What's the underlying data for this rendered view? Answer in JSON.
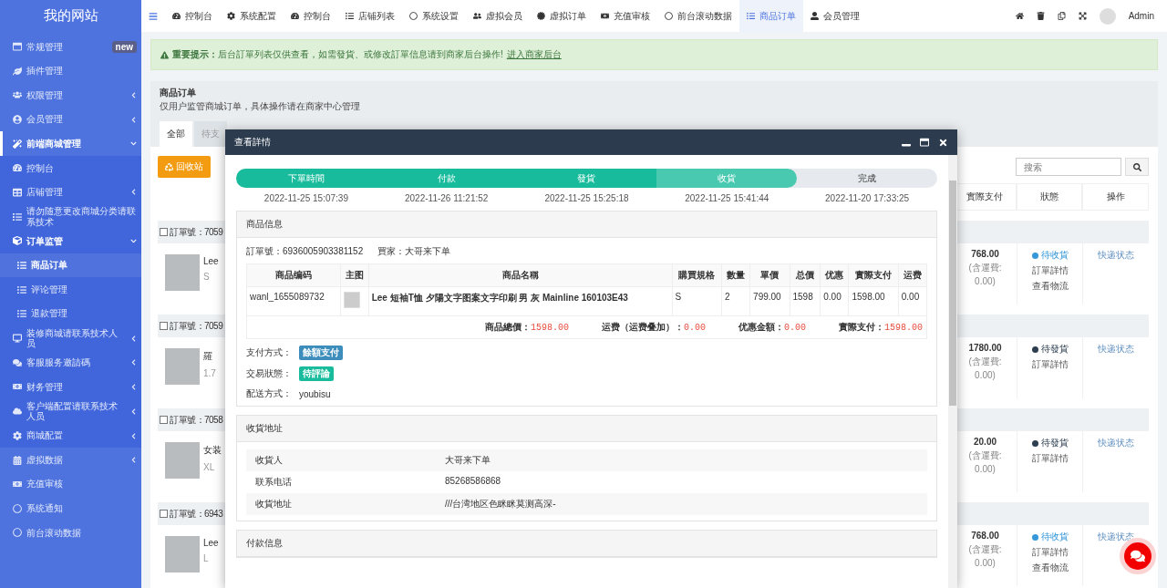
{
  "sidebar": {
    "title": "我的网站",
    "items": [
      {
        "label": "常规管理",
        "badge": "new",
        "selected": false
      },
      {
        "label": "插件管理",
        "selected": false
      },
      {
        "label": "权限管理",
        "expanded": false,
        "selected": false
      },
      {
        "label": "会员管理",
        "expanded": false,
        "selected": false
      },
      {
        "label": "前端商城管理",
        "expanded": true,
        "selected": false,
        "children": [
          {
            "label": "控制台",
            "selected": false
          },
          {
            "label": "店铺管理",
            "expanded": false,
            "selected": false
          },
          {
            "label": "请勿随意更改商城分类请联系技术",
            "selected": false
          },
          {
            "label": "订单监管",
            "expanded": true,
            "selected": false,
            "children": [
              {
                "label": "商品订单",
                "selected": true
              },
              {
                "label": "评论管理",
                "selected": false
              },
              {
                "label": "退款管理",
                "selected": false
              }
            ]
          },
          {
            "label": "装修商城请联系技术人员",
            "expanded": false,
            "selected": false
          },
          {
            "label": "客服服务邀請碼",
            "expanded": false,
            "selected": false
          },
          {
            "label": "财务管理",
            "expanded": false,
            "selected": false
          },
          {
            "label": "客户端配置请联系技术人员",
            "expanded": false,
            "selected": false
          },
          {
            "label": "商城配置",
            "expanded": false,
            "selected": false
          }
        ]
      },
      {
        "label": "虚拟数据",
        "expanded": false,
        "selected": false
      },
      {
        "label": "充值审核",
        "selected": false
      },
      {
        "label": "系统通知",
        "selected": false
      },
      {
        "label": "前台滚动数据",
        "selected": false
      }
    ]
  },
  "topnav": {
    "tabs": [
      {
        "label": "控制台",
        "selected": false
      },
      {
        "label": "系统配置",
        "selected": false
      },
      {
        "label": "控制台",
        "selected": false
      },
      {
        "label": "店铺列表",
        "selected": false
      },
      {
        "label": "系统设置",
        "selected": false
      },
      {
        "label": "虚拟会员",
        "selected": false
      },
      {
        "label": "虚拟订单",
        "selected": false
      },
      {
        "label": "充值审核",
        "selected": false
      },
      {
        "label": "前台滚动数据",
        "selected": false
      },
      {
        "label": "商品订单",
        "selected": true
      },
      {
        "label": "会员管理",
        "selected": false
      }
    ],
    "user": "Admin"
  },
  "notice": {
    "text": "**重要提示：**后台訂單列表仅供查看，如需發貨、或修改訂單信息请到商家后台操作!",
    "link": "进入商家后台"
  },
  "page": {
    "title": "商品订单",
    "subtitle": "仅用户监管商城订单，具体操作请在商家中心管理",
    "tabs": [
      {
        "label": "全部",
        "selected": true
      },
      {
        "label": "待支",
        "selected": false
      }
    ],
    "recycle_button": "回收站",
    "search": {
      "placeholder": "搜索"
    },
    "columns": [
      "實際支付",
      "狀態",
      "操作"
    ],
    "orders": [
      {
        "checked": false,
        "order_no": "訂單號：7059",
        "product": "Lee",
        "spec": "S",
        "total": "768.00",
        "shipping": "(含運費: 0.00)",
        "status": "待收貨",
        "color": "#3498db",
        "links": [
          "訂單詳情",
          "查看物流"
        ],
        "action": "快递状态"
      },
      {
        "checked": false,
        "order_no": "訂單號：7059",
        "product": "羅",
        "spec": "1.7",
        "total": "1780.00",
        "shipping": "(含運費: 0.00)",
        "status": "待發貨",
        "color": "#2c3e50",
        "links": [
          "訂單詳情"
        ],
        "action": "快递状态"
      },
      {
        "checked": false,
        "order_no": "訂單號：7058",
        "product": "女装",
        "spec": "XL",
        "total": "20.00",
        "shipping": "(含運費: 0.00)",
        "status": "待發貨",
        "color": "#2c3e50",
        "links": [
          "訂單詳情"
        ],
        "action": "快递状态"
      },
      {
        "checked": false,
        "order_no": "訂單號：6943",
        "product": "Lee",
        "spec": "L",
        "total": "768.00",
        "shipping": "(含運費: 0.00)",
        "status": "待收貨",
        "color": "#3498db",
        "links": [
          "訂單詳情",
          "查看物流"
        ],
        "action": "快递状态"
      }
    ]
  },
  "modal": {
    "title": "查看詳情",
    "steps": [
      {
        "label": "下單時間",
        "done": true,
        "selected": false,
        "time": "2022-11-25 15:07:39"
      },
      {
        "label": "付款",
        "done": true,
        "selected": false,
        "time": "2022-11-26 11:21:52"
      },
      {
        "label": "發貨",
        "done": true,
        "selected": false,
        "time": "2022-11-25 15:25:18"
      },
      {
        "label": "收貨",
        "done": true,
        "selected": true,
        "time": "2022-11-25 15:41:44"
      },
      {
        "label": "完成",
        "done": false,
        "selected": false,
        "time": "2022-11-20 17:33:25"
      }
    ],
    "goods": {
      "title": "商品信息",
      "order_no": "訂單號：6936005903381152",
      "buyer": "買家：大哥来下单",
      "columns": [
        "商品编码",
        "主图",
        "商品名稱",
        "購買規格",
        "數量",
        "單價",
        "总價",
        "优惠",
        "實際支付",
        "运费"
      ],
      "rows": [
        {
          "code": "wanl_1655089732",
          "name": "Lee 短袖T恤 夕陽文字图案文字印刷 男 灰 Mainline 160103E43",
          "spec": "S",
          "qty": "2",
          "price": "799.00",
          "total": "1598",
          "discount": "0.00",
          "paid": "1598.00",
          "freight": "0.00"
        }
      ],
      "summary": [
        {
          "label": "商品總價：",
          "value": "1598.00"
        },
        {
          "label": "运费（运费叠加）：",
          "value": "0.00"
        },
        {
          "label": "优惠金額：",
          "value": "0.00"
        },
        {
          "label": "實際支付：",
          "value": "1598.00"
        }
      ],
      "fields": [
        {
          "label": "支付方式：",
          "kind": "badge",
          "value": "餘額支付",
          "color": "#3c8dbc"
        },
        {
          "label": "交易狀態：",
          "kind": "badge",
          "value": "待評論",
          "color": "#18bc9c"
        },
        {
          "label": "配送方式：",
          "kind": "text",
          "value": "youbisu"
        }
      ]
    },
    "address": {
      "title": "收貨地址",
      "rows": [
        {
          "label": "收貨人",
          "value": "大哥来下单"
        },
        {
          "label": "联系电话",
          "value": "85268586868"
        },
        {
          "label": "收貨地址",
          "value": "///台湾地区色眯眯莫测高深-"
        }
      ]
    },
    "payment": {
      "title": "付款信息"
    }
  }
}
